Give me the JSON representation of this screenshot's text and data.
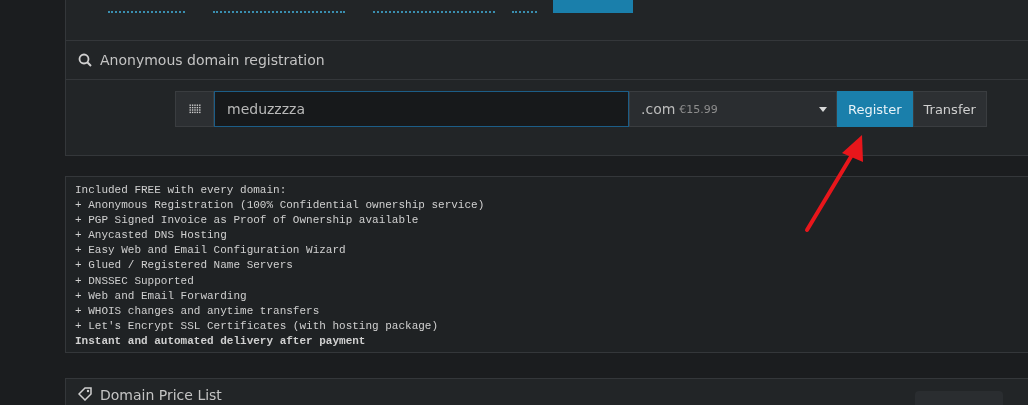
{
  "tabs": [
    {
      "selected": false
    },
    {
      "selected": false
    },
    {
      "selected": false
    },
    {
      "selected": false
    },
    {
      "selected": true
    }
  ],
  "registration": {
    "title": "Anonymous domain registration",
    "domain_field": {
      "value": "meduzzzza"
    },
    "tld_select": {
      "tld": ".com",
      "price": "€15.99"
    },
    "buttons": [
      {
        "label": "Register",
        "primary": true
      },
      {
        "label": "Transfer",
        "primary": false
      }
    ]
  },
  "features": {
    "heading": "Included FREE with every domain:",
    "items": [
      "+ Anonymous Registration (100% Confidential ownership service)",
      "+ PGP Signed Invoice as Proof of Ownership available",
      "+ Anycasted DNS Hosting",
      "+ Easy Web and Email Configuration Wizard",
      "+ Glued / Registered Name Servers",
      "+ DNSSEC Supported",
      "+ Web and Email Forwarding",
      "+ WHOIS changes and anytime transfers",
      "+ Let's Encrypt SSL Certificates (with hosting package)"
    ],
    "footer": "Instant and automated delivery after payment"
  },
  "price_list": {
    "title": "Domain Price List"
  }
}
